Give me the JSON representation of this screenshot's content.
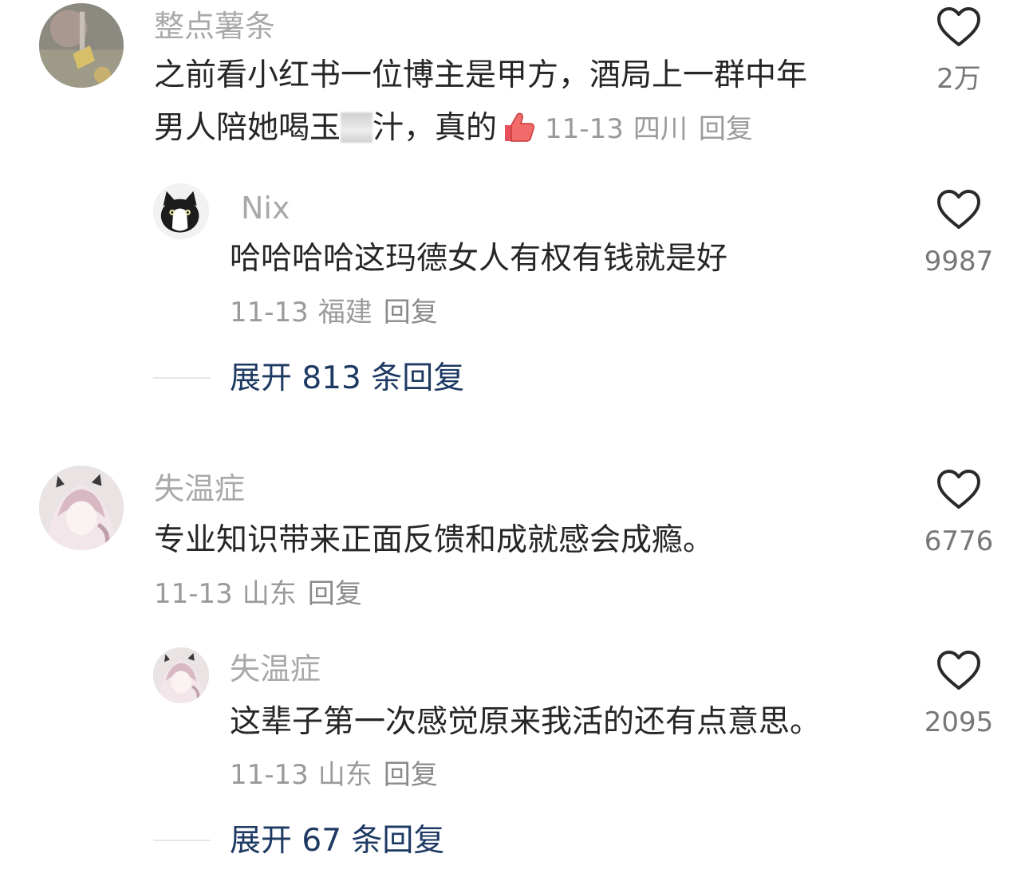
{
  "comments": [
    {
      "user": "整点薯条",
      "text_line1": "之前看小红书一位博主是甲方，酒局上一群中年",
      "text_line2_before": "男人陪她喝玉",
      "text_line2_after": "汁，真的",
      "date": "11-13",
      "location": "四川",
      "reply": "回复",
      "likes": "2万",
      "avatar_icon": "photo-avatar",
      "emoji": "thumbs-up-emoji"
    },
    {
      "user": "Nix",
      "text": "哈哈哈哈这玛德女人有权有钱就是好",
      "date": "11-13",
      "location": "福建",
      "reply": "回复",
      "likes": "9987",
      "avatar_icon": "cat-avatar"
    },
    {
      "user": "失温症",
      "text": "专业知识带来正面反馈和成就感会成瘾。",
      "date": "11-13",
      "location": "山东",
      "reply": "回复",
      "likes": "6776",
      "avatar_icon": "anime-avatar"
    },
    {
      "user": "失温症",
      "text": "这辈子第一次感觉原来我活的还有点意思。",
      "date": "11-13",
      "location": "山东",
      "reply": "回复",
      "likes": "2095",
      "avatar_icon": "anime-avatar"
    }
  ],
  "expand1": "展开 813 条回复",
  "expand2": "展开 67 条回复",
  "colors": {
    "username": "#a9a9a9",
    "text": "#262626",
    "meta": "#9a9a9a",
    "expand": "#1e3a63"
  }
}
